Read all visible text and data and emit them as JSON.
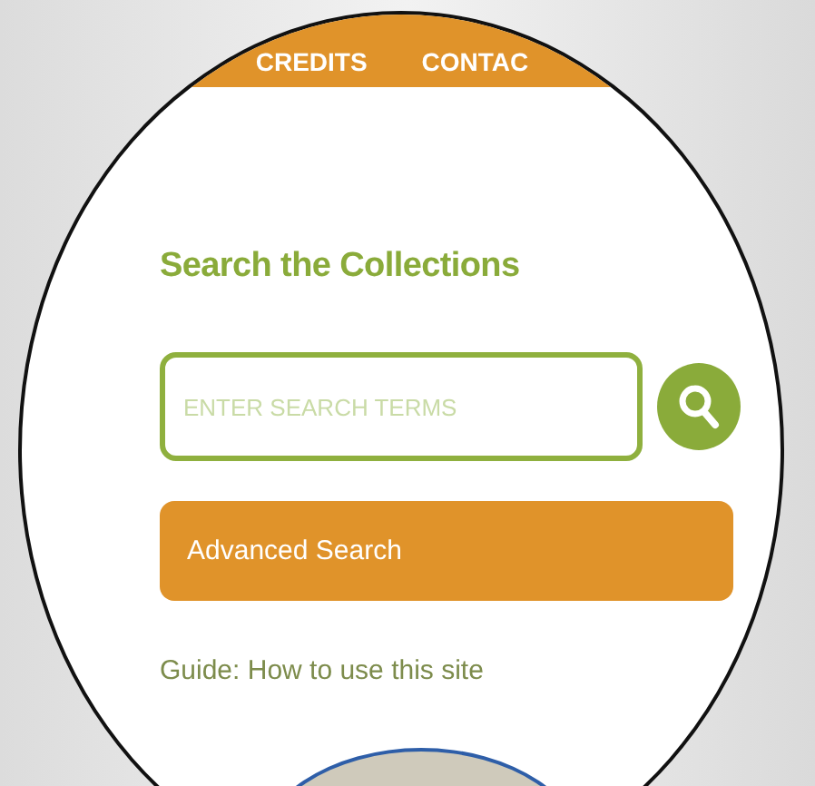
{
  "nav": [
    {
      "label": "CREDITS"
    },
    {
      "label": "CONTAC"
    }
  ],
  "heading": "Search the Collections",
  "search": {
    "placeholder": "ENTER SEARCH TERMS"
  },
  "advanced_button": "Advanced Search",
  "guide_link": "Guide: How to use this site"
}
